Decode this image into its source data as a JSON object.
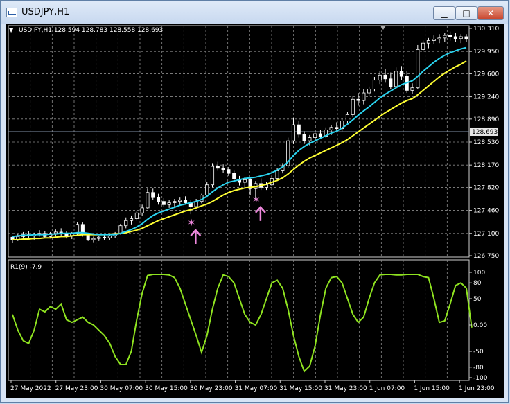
{
  "window": {
    "title": "USDJPY,H1",
    "buttons": {
      "minimize": "▁",
      "maximize": "□",
      "close": "✕"
    }
  },
  "chart": {
    "legend": "USDJPY,H1  128.594 128.783 128.558 128.693",
    "current_price": "128.693",
    "price_labels": [
      "130.310",
      "129.950",
      "129.600",
      "129.240",
      "128.890",
      "128.530",
      "128.170",
      "127.820",
      "127.460",
      "127.100",
      "126.750"
    ],
    "indicator_label": "R1(9) -7.9",
    "indicator_labels": [
      "100",
      "80",
      "50",
      "0.00",
      "-50",
      "-80",
      "-100"
    ],
    "time_labels": [
      "27 May 2022",
      "27 May 23:00",
      "30 May 07:00",
      "30 May 15:00",
      "30 May 23:00",
      "31 May 07:00",
      "31 May 15:00",
      "31 May 23:00",
      "1 Jun 07:00",
      "1 Jun 15:00",
      "1 Jun 23:00"
    ],
    "colors": {
      "bull": "#ffffff",
      "bear": "#ffffff",
      "candle_up": "#00ff00",
      "ma_fast": "#2ad4f0",
      "ma_slow": "#ffff33",
      "indicator": "#8fe320",
      "arrow": "#ee88dd",
      "grid": "#8a8a8a"
    }
  },
  "chart_data": {
    "type": "candlestick",
    "price_range": [
      126.75,
      130.31
    ],
    "candles": [
      [
        127.04,
        127.06,
        126.95,
        127.0
      ],
      [
        127.0,
        127.1,
        126.98,
        127.05
      ],
      [
        127.05,
        127.12,
        127.0,
        127.08
      ],
      [
        127.08,
        127.14,
        127.02,
        127.06
      ],
      [
        127.06,
        127.11,
        127.0,
        127.09
      ],
      [
        127.09,
        127.15,
        127.05,
        127.1
      ],
      [
        127.1,
        127.14,
        127.03,
        127.05
      ],
      [
        127.05,
        127.12,
        127.02,
        127.1
      ],
      [
        127.1,
        127.16,
        127.05,
        127.12
      ],
      [
        127.12,
        127.18,
        127.06,
        127.09
      ],
      [
        127.09,
        127.14,
        127.02,
        127.06
      ],
      [
        127.06,
        127.12,
        127.01,
        127.1
      ],
      [
        127.1,
        127.27,
        127.08,
        127.24
      ],
      [
        127.24,
        127.27,
        127.05,
        127.08
      ],
      [
        127.08,
        127.1,
        126.98,
        127.0
      ],
      [
        127.0,
        127.05,
        126.96,
        127.02
      ],
      [
        127.02,
        127.06,
        126.98,
        127.04
      ],
      [
        127.04,
        127.08,
        127.0,
        127.03
      ],
      [
        127.03,
        127.1,
        127.0,
        127.06
      ],
      [
        127.06,
        127.12,
        127.03,
        127.1
      ],
      [
        127.1,
        127.25,
        127.08,
        127.22
      ],
      [
        127.22,
        127.35,
        127.18,
        127.3
      ],
      [
        127.3,
        127.38,
        127.24,
        127.33
      ],
      [
        127.33,
        127.45,
        127.3,
        127.42
      ],
      [
        127.42,
        127.55,
        127.38,
        127.5
      ],
      [
        127.5,
        127.8,
        127.48,
        127.74
      ],
      [
        127.74,
        127.8,
        127.62,
        127.66
      ],
      [
        127.66,
        127.72,
        127.55,
        127.6
      ],
      [
        127.6,
        127.65,
        127.52,
        127.55
      ],
      [
        127.55,
        127.62,
        127.5,
        127.58
      ],
      [
        127.58,
        127.64,
        127.52,
        127.6
      ],
      [
        127.6,
        127.66,
        127.54,
        127.62
      ],
      [
        127.62,
        127.68,
        127.55,
        127.58
      ],
      [
        127.58,
        127.62,
        127.4,
        127.52
      ],
      [
        127.52,
        127.64,
        127.5,
        127.6
      ],
      [
        127.6,
        127.72,
        127.57,
        127.7
      ],
      [
        127.7,
        127.9,
        127.66,
        127.86
      ],
      [
        127.86,
        128.2,
        127.82,
        128.15
      ],
      [
        128.15,
        128.22,
        128.08,
        128.12
      ],
      [
        128.12,
        128.18,
        128.05,
        128.1
      ],
      [
        128.1,
        128.14,
        128.0,
        128.04
      ],
      [
        128.04,
        128.08,
        127.9,
        127.95
      ],
      [
        127.95,
        128.0,
        127.85,
        127.9
      ],
      [
        127.9,
        127.98,
        127.82,
        127.94
      ],
      [
        127.94,
        127.98,
        127.7,
        127.8
      ],
      [
        127.8,
        127.92,
        127.62,
        127.88
      ],
      [
        127.88,
        127.96,
        127.78,
        127.82
      ],
      [
        127.82,
        127.9,
        127.78,
        127.86
      ],
      [
        127.86,
        128.0,
        127.84,
        127.96
      ],
      [
        127.96,
        128.12,
        127.92,
        128.08
      ],
      [
        128.08,
        128.2,
        128.04,
        128.16
      ],
      [
        128.16,
        128.6,
        128.12,
        128.55
      ],
      [
        128.55,
        128.9,
        128.5,
        128.8
      ],
      [
        128.8,
        128.86,
        128.6,
        128.65
      ],
      [
        128.65,
        128.7,
        128.5,
        128.55
      ],
      [
        128.55,
        128.64,
        128.48,
        128.6
      ],
      [
        128.6,
        128.7,
        128.55,
        128.66
      ],
      [
        128.66,
        128.72,
        128.58,
        128.62
      ],
      [
        128.62,
        128.76,
        128.6,
        128.72
      ],
      [
        128.72,
        128.8,
        128.64,
        128.76
      ],
      [
        128.76,
        128.84,
        128.68,
        128.74
      ],
      [
        128.74,
        128.9,
        128.7,
        128.86
      ],
      [
        128.86,
        129.0,
        128.82,
        128.96
      ],
      [
        128.96,
        129.25,
        128.92,
        129.2
      ],
      [
        129.2,
        129.3,
        129.1,
        129.18
      ],
      [
        129.18,
        129.36,
        129.12,
        129.3
      ],
      [
        129.3,
        129.4,
        129.24,
        129.36
      ],
      [
        129.36,
        129.55,
        129.32,
        129.5
      ],
      [
        129.5,
        129.64,
        129.44,
        129.58
      ],
      [
        129.58,
        129.68,
        129.46,
        129.52
      ],
      [
        129.52,
        129.62,
        129.36,
        129.4
      ],
      [
        129.4,
        129.7,
        129.38,
        129.64
      ],
      [
        129.64,
        129.72,
        129.5,
        129.56
      ],
      [
        129.56,
        129.64,
        129.3,
        129.34
      ],
      [
        129.34,
        129.45,
        129.28,
        129.38
      ],
      [
        129.38,
        130.05,
        129.36,
        129.98
      ],
      [
        129.98,
        130.12,
        129.94,
        130.08
      ],
      [
        130.08,
        130.16,
        130.0,
        130.12
      ],
      [
        130.12,
        130.2,
        130.06,
        130.14
      ],
      [
        130.14,
        130.22,
        130.08,
        130.16
      ],
      [
        130.16,
        130.24,
        130.1,
        130.2
      ],
      [
        130.2,
        130.26,
        130.12,
        130.18
      ],
      [
        130.18,
        130.24,
        130.1,
        130.15
      ],
      [
        130.15,
        130.22,
        130.08,
        130.18
      ],
      [
        130.18,
        130.22,
        130.1,
        130.14
      ]
    ],
    "ma_fast": [
      127.05,
      127.06,
      127.07,
      127.07,
      127.08,
      127.08,
      127.08,
      127.09,
      127.09,
      127.1,
      127.1,
      127.1,
      127.11,
      127.11,
      127.1,
      127.09,
      127.08,
      127.08,
      127.08,
      127.08,
      127.1,
      127.13,
      127.16,
      127.2,
      127.25,
      127.32,
      127.38,
      127.42,
      127.45,
      127.48,
      127.51,
      127.54,
      127.56,
      127.58,
      127.6,
      127.63,
      127.68,
      127.75,
      127.81,
      127.86,
      127.9,
      127.92,
      127.94,
      127.96,
      127.97,
      127.98,
      128.0,
      128.02,
      128.05,
      128.09,
      128.14,
      128.22,
      128.32,
      128.4,
      128.46,
      128.51,
      128.55,
      128.59,
      128.63,
      128.67,
      128.7,
      128.75,
      128.81,
      128.88,
      128.95,
      129.02,
      129.08,
      129.15,
      129.22,
      129.28,
      129.33,
      129.38,
      129.43,
      129.46,
      129.49,
      129.56,
      129.64,
      129.71,
      129.78,
      129.84,
      129.89,
      129.93,
      129.96,
      129.99,
      130.01
    ],
    "ma_slow": [
      127.0,
      127.0,
      127.01,
      127.01,
      127.02,
      127.02,
      127.03,
      127.03,
      127.04,
      127.05,
      127.05,
      127.06,
      127.07,
      127.08,
      127.08,
      127.08,
      127.08,
      127.08,
      127.09,
      127.09,
      127.1,
      127.11,
      127.13,
      127.15,
      127.18,
      127.22,
      127.26,
      127.3,
      127.33,
      127.36,
      127.39,
      127.42,
      127.45,
      127.47,
      127.5,
      127.53,
      127.56,
      127.6,
      127.65,
      127.7,
      127.74,
      127.77,
      127.79,
      127.81,
      127.82,
      127.83,
      127.85,
      127.87,
      127.9,
      127.93,
      127.97,
      128.03,
      128.1,
      128.17,
      128.23,
      128.28,
      128.32,
      128.36,
      128.4,
      128.44,
      128.48,
      128.52,
      128.57,
      128.63,
      128.69,
      128.75,
      128.81,
      128.87,
      128.93,
      128.99,
      129.04,
      129.09,
      129.14,
      129.18,
      129.21,
      129.27,
      129.34,
      129.41,
      129.48,
      129.55,
      129.61,
      129.66,
      129.71,
      129.75,
      129.8
    ],
    "indicator_range": [
      -100,
      100
    ],
    "indicator_values": [
      20,
      -10,
      -30,
      -35,
      -10,
      30,
      25,
      35,
      30,
      40,
      10,
      5,
      10,
      15,
      5,
      0,
      -10,
      -20,
      -35,
      -60,
      -75,
      -75,
      -50,
      10,
      60,
      94,
      96,
      96,
      96,
      95,
      90,
      70,
      40,
      10,
      -20,
      -52,
      -20,
      30,
      70,
      95,
      92,
      80,
      50,
      20,
      5,
      0,
      20,
      50,
      80,
      85,
      70,
      30,
      -20,
      -60,
      -88,
      -78,
      -40,
      20,
      70,
      90,
      92,
      80,
      50,
      20,
      5,
      15,
      50,
      80,
      95,
      96,
      96,
      95,
      95,
      96,
      96,
      96,
      92,
      90,
      50,
      5,
      8,
      40,
      75,
      80,
      70,
      -5
    ],
    "arrows": [
      [
        33,
        127.26
      ],
      [
        45,
        127.62
      ]
    ],
    "indicator_ticks": [
      100,
      80,
      50,
      0,
      -50,
      -80,
      -100
    ]
  }
}
